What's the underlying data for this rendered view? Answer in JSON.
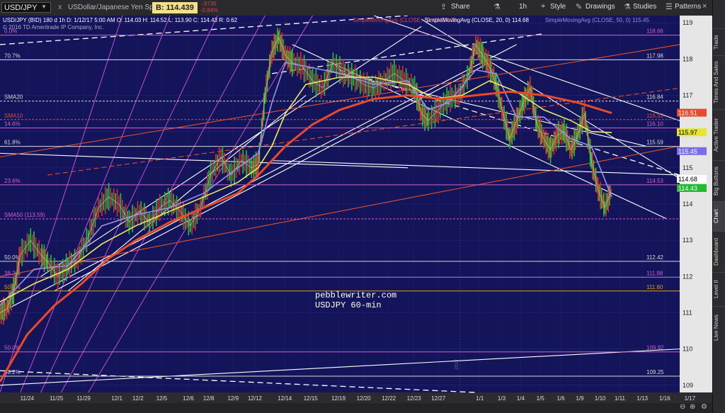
{
  "toolbar": {
    "symbol": "USD/JPY",
    "multiplier_icon": "x",
    "instrument_name": "USDollar/Japanese Yen Spot",
    "bid_label": "B: 114.439",
    "change_value": "-.9735",
    "change_percent": "-0.84%",
    "share_label": "Share",
    "timeframe_label": "1h",
    "style_label": "Style",
    "drawings_label": "Drawings",
    "studies_label": "Studies",
    "patterns_label": "Patterns"
  },
  "sidebar": {
    "tabs": [
      "Trade",
      "Times And Sales",
      "Active Trader",
      "Big Buttons",
      "Chart",
      "Dashboard",
      "Level II",
      "Live News"
    ]
  },
  "chart_info": {
    "header_line": "USD/JPY (BID) 180 d 1h  D: 1/12/17 5:00 AM  O: 114.03  H: 114.52  L: 113.90  C: 114.43  R: 0.62",
    "copyright": "© 2016 TD Ameritrade IP Company, Inc.",
    "study1": "SimpleMovingAvg (CLOSE, 10, 0)  114.25",
    "study2": "SimpleMovingAvg (CLOSE, 20, 0)  114.68",
    "study3": "SimpleMovingAvg (CLOSE, 50, 0)  115.45"
  },
  "annotations": {
    "watermark1": "pebblewriter.com",
    "watermark2": "USDJPY 60-min",
    "year_marker": "2017"
  },
  "chart_data": {
    "type": "line",
    "title": "",
    "xlabel": "",
    "ylabel": "",
    "ylim": [
      108.8,
      119.2
    ],
    "ticks_y": [
      109,
      110,
      111,
      112,
      113,
      114,
      115,
      116,
      117,
      118,
      119
    ],
    "ticks_x": [
      {
        "label": "11/24",
        "pos": 0.04
      },
      {
        "label": "11/25",
        "pos": 0.083
      },
      {
        "label": "11/29",
        "pos": 0.123
      },
      {
        "label": "12/1",
        "pos": 0.172
      },
      {
        "label": "12/2",
        "pos": 0.203
      },
      {
        "label": "12/5",
        "pos": 0.238
      },
      {
        "label": "12/6",
        "pos": 0.277
      },
      {
        "label": "12/8",
        "pos": 0.307
      },
      {
        "label": "12/9",
        "pos": 0.343
      },
      {
        "label": "12/12",
        "pos": 0.375
      },
      {
        "label": "12/14",
        "pos": 0.419
      },
      {
        "label": "12/15",
        "pos": 0.457
      },
      {
        "label": "12/19",
        "pos": 0.498
      },
      {
        "label": "12/20",
        "pos": 0.535
      },
      {
        "label": "12/22",
        "pos": 0.572
      },
      {
        "label": "12/23",
        "pos": 0.609
      },
      {
        "label": "12/27",
        "pos": 0.645
      },
      {
        "label": "1/1",
        "pos": 0.706
      },
      {
        "label": "1/3",
        "pos": 0.738
      },
      {
        "label": "1/4",
        "pos": 0.766
      },
      {
        "label": "1/5",
        "pos": 0.795
      },
      {
        "label": "1/6",
        "pos": 0.825
      },
      {
        "label": "1/9",
        "pos": 0.853
      },
      {
        "label": "1/10",
        "pos": 0.883
      },
      {
        "label": "1/11",
        "pos": 0.912
      },
      {
        "label": "1/13",
        "pos": 0.945
      },
      {
        "label": "1/16",
        "pos": 0.978
      },
      {
        "label": "1/17",
        "pos": 1.015
      }
    ],
    "price_path": [
      [
        0.0,
        111.0
      ],
      [
        0.01,
        111.1
      ],
      [
        0.02,
        111.6
      ],
      [
        0.03,
        112.6
      ],
      [
        0.045,
        113.0
      ],
      [
        0.06,
        112.6
      ],
      [
        0.07,
        112.4
      ],
      [
        0.085,
        112.0
      ],
      [
        0.1,
        112.3
      ],
      [
        0.115,
        112.5
      ],
      [
        0.13,
        113.1
      ],
      [
        0.145,
        113.9
      ],
      [
        0.16,
        114.2
      ],
      [
        0.175,
        114.0
      ],
      [
        0.19,
        113.5
      ],
      [
        0.205,
        113.8
      ],
      [
        0.22,
        113.5
      ],
      [
        0.235,
        113.9
      ],
      [
        0.25,
        114.1
      ],
      [
        0.265,
        113.8
      ],
      [
        0.28,
        113.4
      ],
      [
        0.295,
        113.9
      ],
      [
        0.31,
        114.8
      ],
      [
        0.325,
        115.3
      ],
      [
        0.34,
        114.8
      ],
      [
        0.355,
        115.2
      ],
      [
        0.37,
        115.0
      ],
      [
        0.38,
        115.1
      ],
      [
        0.39,
        117.0
      ],
      [
        0.4,
        118.2
      ],
      [
        0.41,
        118.6
      ],
      [
        0.42,
        118.1
      ],
      [
        0.43,
        117.9
      ],
      [
        0.445,
        117.8
      ],
      [
        0.46,
        117.4
      ],
      [
        0.475,
        117.2
      ],
      [
        0.49,
        117.9
      ],
      [
        0.505,
        117.6
      ],
      [
        0.52,
        117.5
      ],
      [
        0.535,
        117.3
      ],
      [
        0.55,
        117.2
      ],
      [
        0.565,
        117.4
      ],
      [
        0.58,
        117.6
      ],
      [
        0.595,
        117.4
      ],
      [
        0.61,
        117.2
      ],
      [
        0.62,
        116.5
      ],
      [
        0.63,
        116.3
      ],
      [
        0.645,
        116.6
      ],
      [
        0.66,
        116.9
      ],
      [
        0.675,
        117.0
      ],
      [
        0.69,
        117.6
      ],
      [
        0.7,
        118.4
      ],
      [
        0.71,
        118.1
      ],
      [
        0.72,
        117.8
      ],
      [
        0.73,
        117.3
      ],
      [
        0.74,
        116.5
      ],
      [
        0.75,
        115.8
      ],
      [
        0.76,
        116.3
      ],
      [
        0.77,
        116.8
      ],
      [
        0.78,
        117.2
      ],
      [
        0.79,
        116.2
      ],
      [
        0.8,
        115.8
      ],
      [
        0.81,
        115.5
      ],
      [
        0.82,
        115.9
      ],
      [
        0.83,
        116.0
      ],
      [
        0.84,
        115.5
      ],
      [
        0.85,
        115.9
      ],
      [
        0.86,
        116.5
      ],
      [
        0.87,
        115.2
      ],
      [
        0.88,
        114.4
      ],
      [
        0.89,
        113.9
      ],
      [
        0.9,
        114.4
      ]
    ],
    "series": [
      {
        "name": "SMA10",
        "color": "#9b8fe8",
        "values": [
          [
            0.0,
            111.2
          ],
          [
            0.05,
            112.2
          ],
          [
            0.1,
            112.3
          ],
          [
            0.15,
            113.4
          ],
          [
            0.2,
            113.7
          ],
          [
            0.25,
            113.9
          ],
          [
            0.3,
            114.3
          ],
          [
            0.35,
            115.0
          ],
          [
            0.38,
            115.4
          ],
          [
            0.4,
            116.8
          ],
          [
            0.42,
            117.9
          ],
          [
            0.45,
            117.8
          ],
          [
            0.5,
            117.6
          ],
          [
            0.55,
            117.3
          ],
          [
            0.6,
            117.4
          ],
          [
            0.63,
            116.6
          ],
          [
            0.66,
            116.8
          ],
          [
            0.7,
            117.7
          ],
          [
            0.73,
            117.6
          ],
          [
            0.76,
            116.4
          ],
          [
            0.8,
            116.4
          ],
          [
            0.84,
            115.8
          ],
          [
            0.87,
            115.6
          ],
          [
            0.9,
            114.2
          ]
        ]
      },
      {
        "name": "SMA20",
        "color": "#ecec64",
        "values": [
          [
            0.0,
            111.3
          ],
          [
            0.05,
            111.8
          ],
          [
            0.1,
            112.2
          ],
          [
            0.15,
            112.9
          ],
          [
            0.2,
            113.4
          ],
          [
            0.25,
            113.8
          ],
          [
            0.3,
            114.2
          ],
          [
            0.35,
            114.6
          ],
          [
            0.38,
            115.0
          ],
          [
            0.4,
            115.6
          ],
          [
            0.42,
            116.5
          ],
          [
            0.45,
            117.3
          ],
          [
            0.5,
            117.5
          ],
          [
            0.55,
            117.5
          ],
          [
            0.6,
            117.3
          ],
          [
            0.64,
            116.9
          ],
          [
            0.68,
            117.0
          ],
          [
            0.72,
            117.4
          ],
          [
            0.76,
            117.1
          ],
          [
            0.8,
            116.6
          ],
          [
            0.84,
            116.3
          ],
          [
            0.87,
            116.0
          ],
          [
            0.9,
            115.97
          ]
        ]
      },
      {
        "name": "SMA50",
        "color": "#e84a2a",
        "values": [
          [
            0.0,
            109.1
          ],
          [
            0.04,
            110.4
          ],
          [
            0.08,
            111.2
          ],
          [
            0.12,
            111.8
          ],
          [
            0.16,
            112.5
          ],
          [
            0.2,
            113.0
          ],
          [
            0.25,
            113.5
          ],
          [
            0.3,
            113.9
          ],
          [
            0.35,
            114.3
          ],
          [
            0.38,
            114.8
          ],
          [
            0.42,
            115.6
          ],
          [
            0.46,
            116.2
          ],
          [
            0.5,
            116.6
          ],
          [
            0.55,
            116.9
          ],
          [
            0.6,
            117.0
          ],
          [
            0.65,
            116.9
          ],
          [
            0.7,
            117.0
          ],
          [
            0.75,
            117.1
          ],
          [
            0.8,
            117.0
          ],
          [
            0.85,
            116.8
          ],
          [
            0.9,
            116.51
          ]
        ]
      }
    ],
    "levels": [
      {
        "label": "0.0%",
        "value": 118.66,
        "price_label": "118.66",
        "color": "#d060d0"
      },
      {
        "label": "70.7%",
        "value": 117.98,
        "price_label": "117.98",
        "color": "#d8d8d8"
      },
      {
        "label": "SMA20",
        "value": 116.84,
        "price_label": "116.84",
        "color": "#d8d8d8"
      },
      {
        "label": "SMA10",
        "value": 116.33,
        "price_label": "116.33",
        "color": "#e84a2a"
      },
      {
        "label": "14.6%",
        "value": 116.1,
        "price_label": "116.10",
        "color": "#d060d0"
      },
      {
        "label": "61.8%",
        "value": 115.59,
        "price_label": "115.59",
        "color": "#d8d8d8"
      },
      {
        "label": "23.6%",
        "value": 114.53,
        "price_label": "114.53",
        "color": "#d060d0"
      },
      {
        "label": "SMA50 (113.59)",
        "value": 113.59,
        "price_label": "",
        "color": "#d060d0"
      },
      {
        "label": "50.0%",
        "value": 112.42,
        "price_label": "112.42",
        "color": "#d8d8d8"
      },
      {
        "label": "38.2%",
        "value": 111.98,
        "price_label": "111.98",
        "color": "#d060d0"
      },
      {
        "label": "50.0%",
        "value": 111.6,
        "price_label": "111.60",
        "color": "#d8a020"
      },
      {
        "label": "50.0%",
        "value": 109.92,
        "price_label": "109.92",
        "color": "#d060d0"
      },
      {
        "label": "38.2%",
        "value": 109.25,
        "price_label": "109.25",
        "color": "#d8d8d8"
      }
    ],
    "price_tags": [
      {
        "label": "116.51",
        "value": 116.51,
        "color": "#e84a2a"
      },
      {
        "label": "115.97",
        "value": 115.97,
        "color": "#e6e62a"
      },
      {
        "label": "115.45",
        "value": 115.45,
        "color": "#7a6ee6"
      },
      {
        "label": "114.68",
        "value": 114.68,
        "color": "#ffffff"
      },
      {
        "label": "114.43",
        "value": 114.43,
        "color": "#22bb33"
      }
    ]
  }
}
